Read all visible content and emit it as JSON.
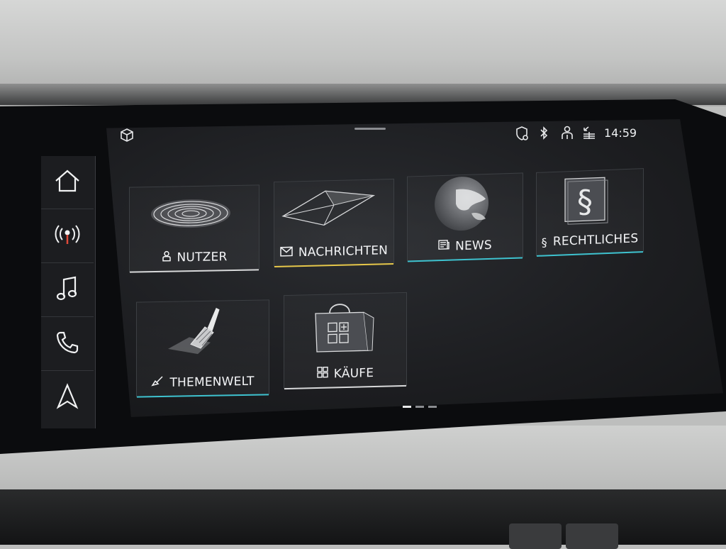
{
  "status_bar": {
    "time": "14:59",
    "icons": [
      "cube-icon",
      "shield-icon",
      "bluetooth-icon",
      "user-icon",
      "data-icon"
    ]
  },
  "sidebar": {
    "items": [
      {
        "name": "home",
        "icon": "home-icon"
      },
      {
        "name": "radio",
        "icon": "radio-icon"
      },
      {
        "name": "media",
        "icon": "music-note-icon"
      },
      {
        "name": "phone",
        "icon": "phone-icon"
      },
      {
        "name": "navigation",
        "icon": "navigation-arrow-icon"
      }
    ]
  },
  "tiles": [
    {
      "id": "nutzer",
      "label": "NUTZER",
      "icon": "user-icon",
      "accent": "#d8d9da"
    },
    {
      "id": "nachrichten",
      "label": "NACHRICHTEN",
      "icon": "mail-icon",
      "accent": "#e6c74a"
    },
    {
      "id": "news",
      "label": "NEWS",
      "icon": "newspaper-icon",
      "accent": "#3ec2cf"
    },
    {
      "id": "rechtliches",
      "label": "RECHTLICHES",
      "icon": "paragraph-icon",
      "accent": "#3ec2cf"
    },
    {
      "id": "themenwelt",
      "label": "THEMENWELT",
      "icon": "brush-icon",
      "accent": "#3ec2cf"
    },
    {
      "id": "kaeufe",
      "label": "KÄUFE",
      "icon": "grid-plus-icon",
      "accent": "#d8d9da"
    }
  ],
  "page_indicator": {
    "count": 3,
    "active": 0
  }
}
